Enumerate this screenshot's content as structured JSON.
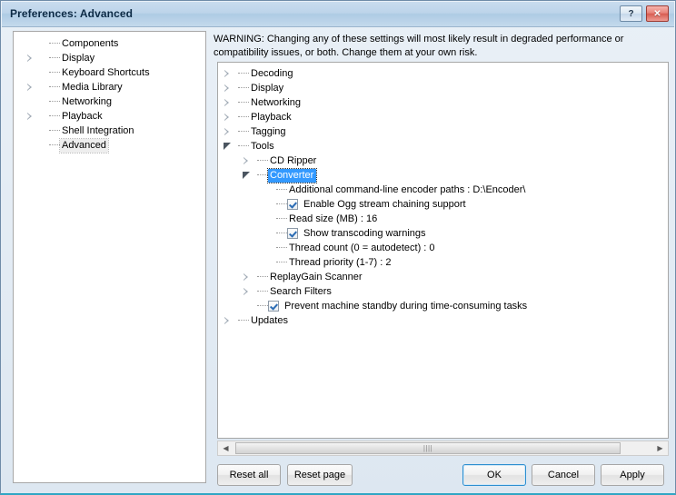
{
  "window": {
    "title": "Preferences: Advanced",
    "help_button": "?",
    "close_button": "✕",
    "accent_title_color": "#aecbe4",
    "selection_color": "#3399ff",
    "focus_border_color": "#2e8fd0"
  },
  "sidebar": {
    "items": [
      {
        "label": "Components",
        "expander": "none",
        "selected": false
      },
      {
        "label": "Display",
        "expander": "collapsed",
        "selected": false
      },
      {
        "label": "Keyboard Shortcuts",
        "expander": "none",
        "selected": false
      },
      {
        "label": "Media Library",
        "expander": "collapsed",
        "selected": false
      },
      {
        "label": "Networking",
        "expander": "none",
        "selected": false
      },
      {
        "label": "Playback",
        "expander": "collapsed",
        "selected": false
      },
      {
        "label": "Shell Integration",
        "expander": "none",
        "selected": false
      },
      {
        "label": "Advanced",
        "expander": "none",
        "selected": true
      }
    ]
  },
  "main": {
    "warning": "WARNING: Changing any of these settings will most likely result in degraded performance or compatibility issues, or both. Change them at your own risk.",
    "tree": [
      {
        "label": "Decoding",
        "depth": 0,
        "expander": "collapsed",
        "checkbox": "none",
        "selected": false
      },
      {
        "label": "Display",
        "depth": 0,
        "expander": "collapsed",
        "checkbox": "none",
        "selected": false
      },
      {
        "label": "Networking",
        "depth": 0,
        "expander": "collapsed",
        "checkbox": "none",
        "selected": false
      },
      {
        "label": "Playback",
        "depth": 0,
        "expander": "collapsed",
        "checkbox": "none",
        "selected": false
      },
      {
        "label": "Tagging",
        "depth": 0,
        "expander": "collapsed",
        "checkbox": "none",
        "selected": false
      },
      {
        "label": "Tools",
        "depth": 0,
        "expander": "expanded",
        "checkbox": "none",
        "selected": false
      },
      {
        "label": "CD Ripper",
        "depth": 1,
        "expander": "collapsed",
        "checkbox": "none",
        "selected": false
      },
      {
        "label": "Converter",
        "depth": 1,
        "expander": "expanded",
        "checkbox": "none",
        "selected": true
      },
      {
        "label": "Additional command-line encoder paths : D:\\Encoder\\",
        "depth": 2,
        "expander": "none",
        "checkbox": "none",
        "selected": false
      },
      {
        "label": "Enable Ogg stream chaining support",
        "depth": 2,
        "expander": "none",
        "checkbox": "checked",
        "selected": false
      },
      {
        "label": "Read size (MB) : 16",
        "depth": 2,
        "expander": "none",
        "checkbox": "none",
        "selected": false
      },
      {
        "label": "Show transcoding warnings",
        "depth": 2,
        "expander": "none",
        "checkbox": "checked",
        "selected": false
      },
      {
        "label": "Thread count (0 = autodetect) : 0",
        "depth": 2,
        "expander": "none",
        "checkbox": "none",
        "selected": false
      },
      {
        "label": "Thread priority (1-7) : 2",
        "depth": 2,
        "expander": "none",
        "checkbox": "none",
        "selected": false
      },
      {
        "label": "ReplayGain Scanner",
        "depth": 1,
        "expander": "collapsed",
        "checkbox": "none",
        "selected": false
      },
      {
        "label": "Search Filters",
        "depth": 1,
        "expander": "collapsed",
        "checkbox": "none",
        "selected": false
      },
      {
        "label": "Prevent machine standby during time-consuming tasks",
        "depth": 1,
        "expander": "none",
        "checkbox": "checked",
        "selected": false
      },
      {
        "label": "Updates",
        "depth": 0,
        "expander": "collapsed",
        "checkbox": "none",
        "selected": false
      }
    ]
  },
  "scrollbar": {
    "left_arrow": "◀",
    "right_arrow": "▶",
    "grip": "||||"
  },
  "buttons": {
    "reset_all": "Reset all",
    "reset_page": "Reset page",
    "ok": "OK",
    "cancel": "Cancel",
    "apply": "Apply"
  }
}
